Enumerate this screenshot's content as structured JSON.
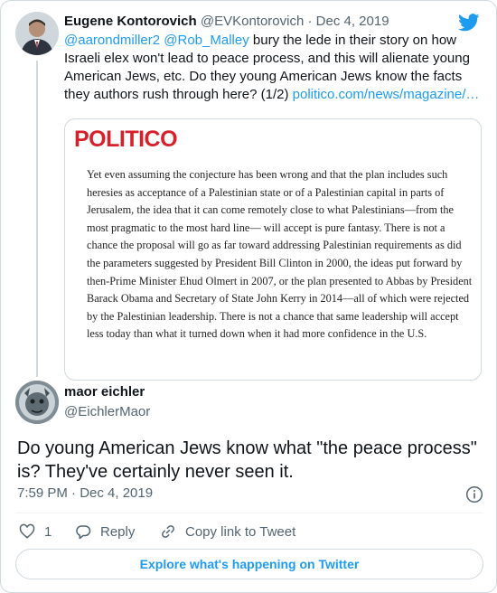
{
  "parent_tweet": {
    "display_name": "Eugene Kontorovich",
    "handle": "@EVKontorovich",
    "separator": "·",
    "date": "Dec 4, 2019",
    "mention1": "@aarondmiller2",
    "mention2": "@Rob_Malley",
    "text_part": " bury the lede in their story on how Israeli elex won't lead to peace process, and this will alienate young American Jews, etc. Do they young American Jews know the facts they authors rush through here? (1/2) ",
    "link": "politico.com/news/magazine/…",
    "quote_card": {
      "logo_text": "POLITICO",
      "excerpt": "Yet even assuming the conjecture has been wrong and that the plan includes such heresies as acceptance of a Palestinian state or of a Palestinian capital in parts of Jerusalem, the idea that it can come remotely close to what Palestinians—from the most pragmatic to the most hard line— will accept is pure fantasy. There is not a chance the proposal will go as far toward addressing Palestinian requirements as did the parameters suggested by President Bill Clinton in 2000, the ideas put forward by then-Prime Minister Ehud Olmert in 2007, or the plan presented to Abbas by President Barack Obama and Secretary of State John Kerry in 2014—all of which were rejected by the Palestinian leadership. There is not a chance that same leadership will accept less today than what it turned down when it had more confidence in the U.S."
    }
  },
  "reply_tweet": {
    "display_name": "maor eichler",
    "handle": "@EichlerMaor",
    "text": "Do young American Jews know what \"the peace process\" is? They've certainly never seen it.",
    "timestamp": "7:59 PM · Dec 4, 2019"
  },
  "actions": {
    "like_count": "1",
    "reply_label": "Reply",
    "copy_link_label": "Copy link to Tweet"
  },
  "explore_label": "Explore what's happening on Twitter",
  "colors": {
    "accent": "#1d9bf0",
    "politico_red": "#d6212b",
    "muted_text": "#536471",
    "border": "#cfd9de"
  },
  "icons": [
    "twitter-bird-icon",
    "info-icon",
    "heart-icon",
    "reply-icon",
    "link-icon"
  ]
}
